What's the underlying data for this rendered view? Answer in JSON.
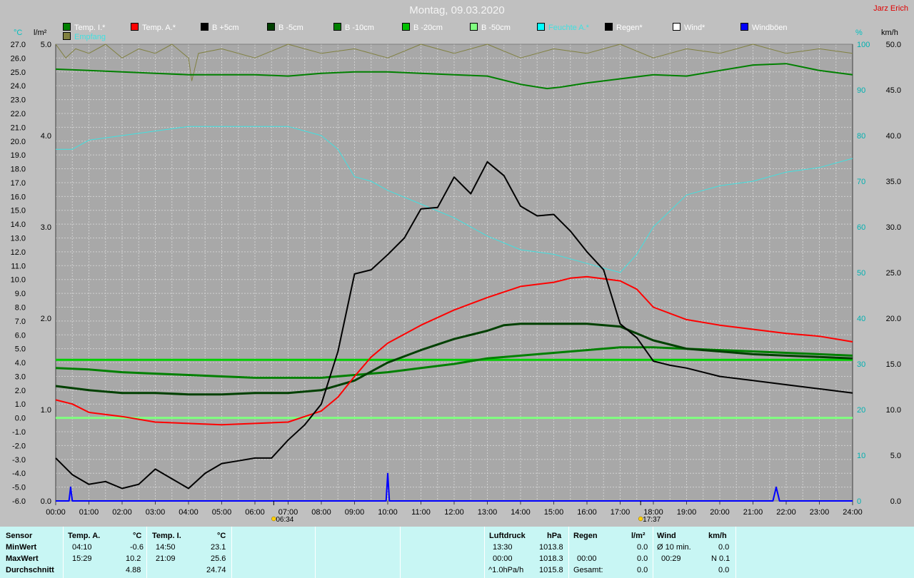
{
  "title": "Montag, 09.03.2020",
  "author": "Jarz Erich",
  "legend": [
    {
      "label": "Temp. I.*",
      "color": "#008000"
    },
    {
      "label": "Temp. A.*",
      "color": "#ff0000"
    },
    {
      "label": "B +5cm",
      "color": "#000000"
    },
    {
      "label": "B -5cm",
      "color": "#004000"
    },
    {
      "label": "B -10cm",
      "color": "#008000"
    },
    {
      "label": "B -20cm",
      "color": "#00c000"
    },
    {
      "label": "B -50cm",
      "color": "#80ff80"
    },
    {
      "label": "Feuchte A.*",
      "color": "#00ffff"
    },
    {
      "label": "Regen*",
      "color": "#000000"
    },
    {
      "label": "Wind*",
      "color": "#ffffff"
    },
    {
      "label": "Windböen",
      "color": "#0000ff"
    },
    {
      "label": "Empfang",
      "color": "#808040"
    }
  ],
  "units": {
    "left1": "°C",
    "left2": "l/m²",
    "right1": "%",
    "right2": "km/h"
  },
  "sun": {
    "rise": "06:34",
    "set": "17:37"
  },
  "chart_data": {
    "type": "line",
    "title": "Montag, 09.03.2020",
    "x_unit": "hours",
    "xlim": [
      0,
      24
    ],
    "x_ticks": [
      "00:00",
      "01:00",
      "02:00",
      "03:00",
      "04:00",
      "05:00",
      "06:00",
      "07:00",
      "08:00",
      "09:00",
      "10:00",
      "11:00",
      "12:00",
      "13:00",
      "14:00",
      "15:00",
      "16:00",
      "17:00",
      "18:00",
      "19:00",
      "20:00",
      "21:00",
      "22:00",
      "23:00",
      "24:00"
    ],
    "temp_axis": {
      "unit": "°C",
      "ylim": [
        -6,
        27
      ],
      "ticks": [
        "-6.0",
        "-5.0",
        "-4.0",
        "-3.0",
        "-2.0",
        "-1.0",
        "0.0",
        "1.0",
        "2.0",
        "3.0",
        "4.0",
        "5.0",
        "6.0",
        "7.0",
        "8.0",
        "9.0",
        "10.0",
        "11.0",
        "12.0",
        "13.0",
        "14.0",
        "15.0",
        "16.0",
        "17.0",
        "18.0",
        "19.0",
        "20.0",
        "21.0",
        "22.0",
        "23.0",
        "24.0",
        "25.0",
        "26.0",
        "27.0"
      ]
    },
    "rain_axis": {
      "unit": "l/m²",
      "ylim": [
        0,
        5
      ],
      "ticks": [
        "0.0",
        "1.0",
        "2.0",
        "3.0",
        "4.0",
        "5.0"
      ]
    },
    "humidity_axis": {
      "unit": "%",
      "ylim": [
        0,
        100
      ],
      "ticks": [
        "0",
        "10",
        "20",
        "30",
        "40",
        "50",
        "60",
        "70",
        "80",
        "90",
        "100"
      ]
    },
    "wind_axis": {
      "unit": "km/h",
      "ylim": [
        0,
        50
      ],
      "ticks": [
        "0.0",
        "5.0",
        "10.0",
        "15.0",
        "20.0",
        "25.0",
        "30.0",
        "35.0",
        "40.0",
        "45.0",
        "50.0"
      ]
    },
    "series": [
      {
        "name": "Temp. I.*",
        "axis": "temp",
        "color": "#008000",
        "width": 2,
        "x": [
          0,
          1,
          2,
          3,
          4,
          5,
          6,
          7,
          8,
          9,
          10,
          11,
          12,
          13,
          14,
          14.8,
          15.2,
          16,
          17,
          18,
          19,
          20,
          21,
          22,
          23,
          24
        ],
        "y": [
          25.2,
          25.1,
          25.0,
          24.9,
          24.8,
          24.8,
          24.8,
          24.7,
          24.9,
          25.0,
          25.0,
          24.9,
          24.8,
          24.7,
          24.1,
          23.8,
          23.9,
          24.2,
          24.5,
          24.8,
          24.7,
          25.1,
          25.5,
          25.6,
          25.1,
          24.8
        ]
      },
      {
        "name": "Temp. A.*",
        "axis": "temp",
        "color": "#ff0000",
        "width": 2,
        "x": [
          0,
          0.5,
          1,
          2,
          3,
          4,
          5,
          6,
          7,
          7.5,
          8,
          8.5,
          9,
          9.5,
          10,
          11,
          12,
          13,
          14,
          15,
          15.5,
          16,
          17,
          17.5,
          18,
          19,
          20,
          21,
          22,
          23,
          24
        ],
        "y": [
          1.3,
          1.0,
          0.4,
          0.1,
          -0.3,
          -0.4,
          -0.5,
          -0.4,
          -0.3,
          0.1,
          0.5,
          1.5,
          3.0,
          4.4,
          5.4,
          6.7,
          7.8,
          8.7,
          9.5,
          9.8,
          10.1,
          10.2,
          9.9,
          9.3,
          8.0,
          7.1,
          6.7,
          6.4,
          6.1,
          5.9,
          5.5
        ]
      },
      {
        "name": "B +5cm",
        "axis": "temp",
        "color": "#000000",
        "width": 2,
        "x": [
          0,
          0.5,
          1,
          1.5,
          2,
          2.5,
          3,
          3.5,
          4,
          4.5,
          5,
          5.5,
          6,
          6.5,
          7,
          7.5,
          8,
          8.5,
          9,
          9.5,
          10,
          10.5,
          11,
          11.5,
          12,
          12.5,
          13,
          13.5,
          14,
          14.5,
          15,
          15.5,
          16,
          16.5,
          17,
          17.5,
          18,
          18.5,
          19,
          20,
          21,
          22,
          23,
          24
        ],
        "y": [
          -2.9,
          -4.1,
          -4.8,
          -4.6,
          -5.1,
          -4.8,
          -3.7,
          -4.4,
          -5.1,
          -4.0,
          -3.3,
          -3.1,
          -2.9,
          -2.9,
          -1.6,
          -0.5,
          1.0,
          4.8,
          10.4,
          10.7,
          11.8,
          13.0,
          15.1,
          15.2,
          17.4,
          16.2,
          18.5,
          17.5,
          15.3,
          14.6,
          14.7,
          13.5,
          12.0,
          10.7,
          6.8,
          5.8,
          4.1,
          3.8,
          3.6,
          3.0,
          2.7,
          2.4,
          2.1,
          1.8
        ]
      },
      {
        "name": "B -5cm",
        "axis": "temp",
        "color": "#004000",
        "width": 3,
        "x": [
          0,
          1,
          2,
          3,
          4,
          5,
          6,
          7,
          8,
          9,
          10,
          11,
          12,
          13,
          13.5,
          14,
          15,
          16,
          17,
          18,
          19,
          20,
          21,
          22,
          23,
          24
        ],
        "y": [
          2.3,
          2.0,
          1.8,
          1.8,
          1.7,
          1.7,
          1.8,
          1.8,
          2.0,
          2.7,
          4.0,
          4.9,
          5.7,
          6.3,
          6.7,
          6.8,
          6.8,
          6.8,
          6.6,
          5.6,
          5.0,
          4.8,
          4.6,
          4.5,
          4.4,
          4.3
        ]
      },
      {
        "name": "B -10cm",
        "axis": "temp",
        "color": "#008000",
        "width": 3,
        "x": [
          0,
          1,
          2,
          3,
          4,
          5,
          6,
          7,
          8,
          9,
          10,
          11,
          12,
          13,
          14,
          15,
          16,
          17,
          18,
          19,
          20,
          21,
          22,
          23,
          24
        ],
        "y": [
          3.6,
          3.5,
          3.3,
          3.2,
          3.1,
          3.0,
          2.9,
          2.9,
          2.9,
          3.1,
          3.3,
          3.6,
          3.9,
          4.3,
          4.5,
          4.7,
          4.9,
          5.1,
          5.1,
          5.0,
          4.9,
          4.8,
          4.7,
          4.6,
          4.5
        ]
      },
      {
        "name": "B -20cm",
        "axis": "temp",
        "color": "#00d000",
        "width": 3,
        "x": [
          0,
          24
        ],
        "y": [
          4.2,
          4.2
        ]
      },
      {
        "name": "B -50cm",
        "axis": "temp",
        "color": "#80ff80",
        "width": 3,
        "x": [
          0,
          24
        ],
        "y": [
          0.0,
          0.0
        ]
      },
      {
        "name": "Feuchte A.*",
        "axis": "humidity",
        "color": "#40e0e0",
        "width": 1,
        "x": [
          0,
          0.5,
          1,
          2,
          3,
          4,
          5,
          6,
          7,
          7.5,
          8,
          8.5,
          9,
          9.5,
          10,
          11,
          12,
          13,
          14,
          15,
          16,
          16.5,
          17,
          17.5,
          18,
          19,
          20,
          21,
          22,
          23,
          24
        ],
        "y": [
          77,
          77,
          79,
          80,
          81,
          82,
          82,
          82,
          82,
          81,
          80,
          77,
          71,
          70,
          68,
          65,
          62,
          58,
          55,
          54,
          52,
          51,
          50,
          54,
          60,
          67,
          69,
          70,
          72,
          73,
          75
        ]
      },
      {
        "name": "Windböen",
        "axis": "wind",
        "color": "#0000ff",
        "width": 2,
        "x": [
          0,
          0.4,
          0.45,
          0.5,
          9.95,
          10.0,
          10.05,
          21.6,
          21.7,
          21.8,
          24
        ],
        "y": [
          0,
          0,
          1.5,
          0,
          0,
          3.0,
          0,
          0,
          1.5,
          0,
          0
        ]
      },
      {
        "name": "Empfang",
        "axis": "humidity",
        "color": "#808040",
        "width": 1,
        "x": [
          0,
          0.3,
          0.6,
          1,
          1.5,
          2,
          2.5,
          3,
          3.5,
          4,
          4.1,
          4.3,
          5,
          6,
          7,
          8,
          9,
          10,
          11,
          12,
          13,
          14,
          15,
          16,
          17,
          18,
          19,
          20,
          21,
          22,
          23,
          24
        ],
        "y": [
          100,
          97,
          99,
          98,
          100,
          97,
          99,
          98,
          100,
          97,
          92,
          98,
          99,
          97,
          100,
          98,
          99,
          97,
          100,
          98,
          100,
          97,
          99,
          98,
          100,
          97,
          99,
          98,
          100,
          98,
          99,
          98
        ]
      }
    ],
    "legend_position": "top"
  },
  "sensor_table": {
    "col_sensor": "Sensor",
    "rows_labels": [
      "MinWert",
      "MaxWert",
      "Durchschnitt"
    ],
    "temp_a": {
      "header": "Temp. A.",
      "unit": "°C",
      "min_time": "04:10",
      "min_val": "-0.6",
      "max_time": "15:29",
      "max_val": "10.2",
      "avg": "4.88"
    },
    "temp_i": {
      "header": "Temp. I.",
      "unit": "°C",
      "min_time": "14:50",
      "min_val": "23.1",
      "max_time": "21:09",
      "max_val": "25.6",
      "avg": "24.74"
    },
    "pressure": {
      "header": "Luftdruck",
      "unit": "hPa",
      "min_time": "13:30",
      "min_val": "1013.8",
      "max_time": "00:00",
      "max_val": "1018.3",
      "trend": "^1.0hPa/h",
      "trend_val": "1015.8"
    },
    "rain": {
      "header": "Regen",
      "unit": "l/m²",
      "r1_time": "",
      "r1_val": "0.0",
      "r2_time": "00:00",
      "r2_val": "0.0",
      "total_label": "Gesamt:",
      "total_val": "0.0"
    },
    "wind": {
      "header": "Wind",
      "unit": "km/h",
      "r1_label": "Ø 10 min.",
      "r1_val": "0.0",
      "r2_time": "00:29",
      "r2_val": "N 0.1",
      "r3_val": "0.0"
    }
  }
}
